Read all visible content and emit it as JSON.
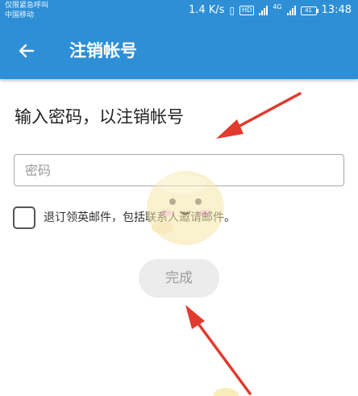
{
  "status_bar": {
    "carrier_line1": "仅限紧急呼叫",
    "carrier_line2": "中国移动",
    "speed": "1.4 K/s",
    "hd_badge": "HD",
    "network": "4G",
    "battery": "41",
    "time": "13:48"
  },
  "app_bar": {
    "back_icon": "arrow-left-icon",
    "title": "注销帐号"
  },
  "form": {
    "heading": "输入密码，以注销帐号",
    "password_placeholder": "密码",
    "password_value": "",
    "unsubscribe_checked": false,
    "unsubscribe_label": "退订领英邮件，包括联系人邀请邮件。",
    "done_label": "完成"
  },
  "colors": {
    "primary": "#2e8fd6",
    "annotation_arrow": "#e03b2e",
    "button_disabled_bg": "#ececec",
    "button_disabled_text": "#9d9d9d"
  }
}
